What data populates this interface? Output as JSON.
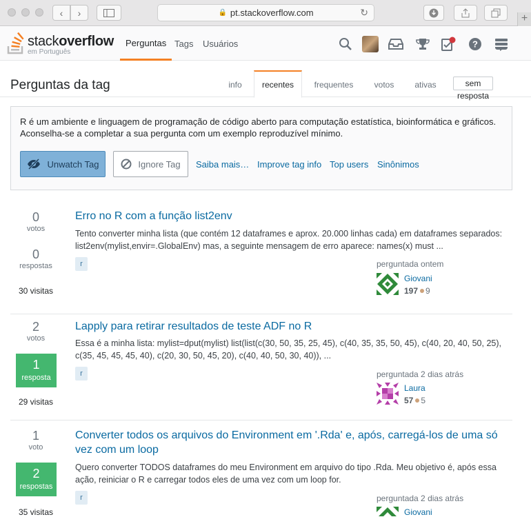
{
  "browser": {
    "url": "pt.stackoverflow.com"
  },
  "header": {
    "logo_main": "stack",
    "logo_bold": "overflow",
    "logo_sub": "em Português",
    "nav": [
      "Perguntas",
      "Tags",
      "Usuários"
    ]
  },
  "page": {
    "title": "Perguntas da tag",
    "tabs": [
      "info",
      "recentes",
      "frequentes",
      "votos",
      "ativas",
      "sem resposta"
    ],
    "active_tab": "recentes"
  },
  "wiki": {
    "line1": "R é um ambiente e linguagem de programação de código aberto para computação estatística, bioinformática e gráficos.",
    "line2": "Aconselha-se a completar a sua pergunta com um exemplo reproduzível mínimo.",
    "watch_label": "Unwatch Tag",
    "ignore_label": "Ignore Tag",
    "links": [
      "Saiba mais…",
      "Improve tag info",
      "Top users",
      "Sinônimos"
    ]
  },
  "questions": [
    {
      "votes": "0",
      "votes_label": "votos",
      "answers": "0",
      "answers_label": "respostas",
      "accepted": false,
      "views": "30 visitas",
      "title": "Erro no R com a função list2env",
      "excerpt": "Tento converter minha lista (que contém 12 dataframes e aprox. 20.000 linhas cada) em dataframes separados: list2env(mylist,envir=.GlobalEnv) mas, a seguinte mensagem de erro aparece: names(x) must ...",
      "tag": "r",
      "asked": "perguntada ontem",
      "user": "Giovani",
      "rep": "197",
      "bronze": "9",
      "avatar_color": "#2f8a3a"
    },
    {
      "votes": "2",
      "votes_label": "votos",
      "answers": "1",
      "answers_label": "resposta",
      "accepted": true,
      "views": "29 visitas",
      "title": "Lapply para retirar resultados de teste ADF no R",
      "excerpt": "Essa é a minha lista: mylist=dput(mylist) list(list(c(30, 50, 35, 25, 45), c(40, 35, 35, 50, 45), c(40, 20, 40, 50, 25), c(35, 45, 45, 45, 40), c(20, 30, 50, 45, 20), c(40, 40, 50, 30, 40)), ...",
      "tag": "r",
      "asked": "perguntada 2 dias atrás",
      "user": "Laura",
      "rep": "57",
      "bronze": "5",
      "avatar_color": "#b43ea8"
    },
    {
      "votes": "1",
      "votes_label": "voto",
      "answers": "2",
      "answers_label": "respostas",
      "accepted": true,
      "views": "35 visitas",
      "title": "Converter todos os arquivos do Environment em '.Rda' e, após, carregá-los de uma só vez com um loop",
      "excerpt": "Quero converter TODOS dataframes do meu Environment em arquivo do tipo .Rda. Meu objetivo é, após essa ação, reiniciar o R e carregar todos eles de uma vez com um loop for.",
      "tag": "r",
      "asked": "perguntada 2 dias atrás",
      "user": "Giovani",
      "rep": "",
      "bronze": "",
      "avatar_color": "#2f8a3a"
    }
  ],
  "colors": {
    "accent": "#f48024",
    "link": "#0a6aa1",
    "accepted": "#44b76f",
    "watch": "#7fb1d8"
  }
}
